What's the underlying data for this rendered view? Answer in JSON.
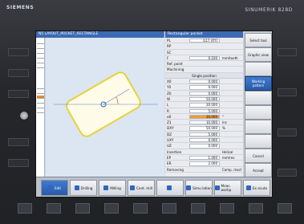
{
  "bezel": {
    "brand": "SIEMENS",
    "model": "SINUMERIK 828D"
  },
  "graphic_window": {
    "title": "N5 LAYOUT_POCKET_RECTANGLE"
  },
  "panel": {
    "title": "Rectangular pocket",
    "rows": [
      {
        "label": "PL",
        "value": "G17 (XY)",
        "unit": "",
        "highlight": false
      },
      {
        "label": "RP",
        "value": "",
        "unit": "",
        "highlight": false
      },
      {
        "label": "SC",
        "value": "",
        "unit": "",
        "highlight": false
      },
      {
        "label": "F",
        "value": "0.100",
        "unit": "mm/tooth",
        "highlight": false
      },
      {
        "label": "Ref. point",
        "value": "",
        "unit": "",
        "highlight": false
      },
      {
        "label": "Machining",
        "value": "",
        "unit": "",
        "highlight": false
      }
    ],
    "section_head": "Single position",
    "rows2": [
      {
        "label": "X0",
        "value": "0.000",
        "unit": "",
        "highlight": false
      },
      {
        "label": "Y0",
        "value": "0.000",
        "unit": "",
        "highlight": false
      },
      {
        "label": "Z0",
        "value": "0.000",
        "unit": "",
        "highlight": false
      },
      {
        "label": "W",
        "value": "50.000",
        "unit": "",
        "highlight": false
      },
      {
        "label": "L",
        "value": "30.000",
        "unit": "",
        "highlight": false
      },
      {
        "label": "R",
        "value": "5.000",
        "unit": "",
        "highlight": false
      },
      {
        "label": "α0",
        "value": "30.000",
        "unit": "°",
        "highlight": true
      },
      {
        "label": "Z1",
        "value": "10.000",
        "unit": "inc",
        "highlight": false
      },
      {
        "label": "DXY",
        "value": "50.000",
        "unit": "%",
        "highlight": false
      },
      {
        "label": "DZ",
        "value": "5.000",
        "unit": "",
        "highlight": false
      },
      {
        "label": "UXY",
        "value": "0.000",
        "unit": "",
        "highlight": false
      },
      {
        "label": "UZ",
        "value": "0.000",
        "unit": "",
        "highlight": false
      },
      {
        "label": "Insertion",
        "value": "",
        "unit": "Helical",
        "highlight": false
      },
      {
        "label": "EP",
        "value": "1.000",
        "unit": "mm/rev",
        "highlight": false
      },
      {
        "label": "ER",
        "value": "2.000",
        "unit": "",
        "highlight": false
      },
      {
        "label": "Removing",
        "value": "",
        "unit": "Comp. machining",
        "highlight": false
      }
    ]
  },
  "vertical_softkeys": [
    {
      "label": "Select tool",
      "active": false
    },
    {
      "label": "Graphic view",
      "active": false
    },
    {
      "label": "",
      "active": false
    },
    {
      "label": "Working pattern",
      "active": true
    },
    {
      "label": "",
      "active": false
    },
    {
      "label": "",
      "active": false
    },
    {
      "label": "",
      "active": false
    },
    {
      "label": "",
      "active": false
    },
    {
      "label": "Cancel",
      "active": false
    },
    {
      "label": "Accept",
      "active": false
    }
  ],
  "horizontal_softkeys": [
    {
      "label": "Edit",
      "active": true
    },
    {
      "label": "Drilling",
      "active": false
    },
    {
      "label": "Milling",
      "active": false
    },
    {
      "label": "Cont. mill",
      "active": false
    },
    {
      "label": "",
      "active": false
    },
    {
      "label": "Simu lation",
      "active": false
    },
    {
      "label": "Meas. workp",
      "active": false
    },
    {
      "label": "Ex ecute",
      "active": false
    }
  ],
  "colors": {
    "accent": "#3c6bb5",
    "highlight": "#f19a2c",
    "pocket_outline": "#e6d23c"
  }
}
